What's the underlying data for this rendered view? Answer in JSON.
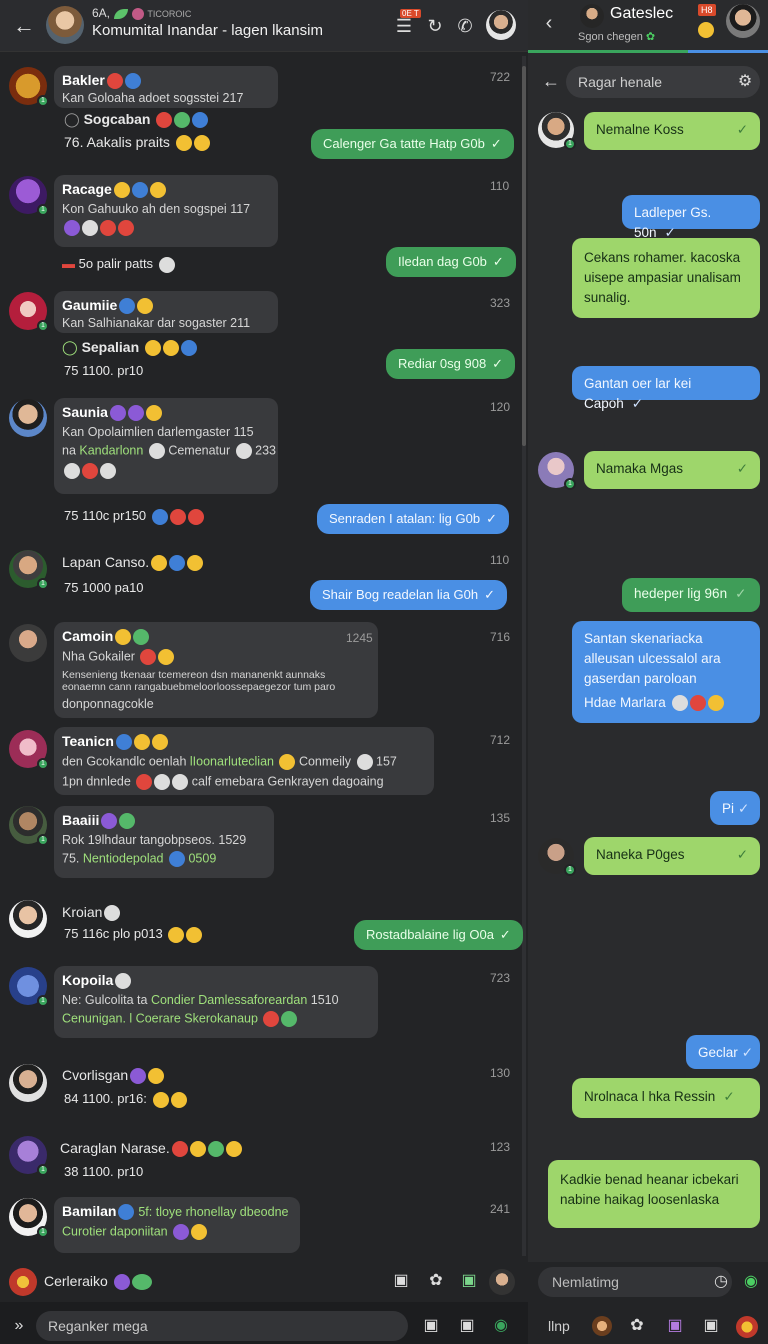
{
  "left": {
    "header": {
      "top_label": "6A,",
      "top_small": "TICOROIC",
      "title": "Komumital Inandar - lagen lkansim",
      "badge": "0E T"
    },
    "messages": [
      {
        "name": "Bakler",
        "line1": "Kan Goloaha adoet sogsstei",
        "num1": "217",
        "line2": "Sogcaban",
        "line3": "76. Aakalis praits",
        "time": "722"
      },
      {
        "name": "Racage",
        "line1": "Kon Gahuuko ah den sogspei",
        "num1": "117",
        "line3": "5o palir patts",
        "time": "110"
      },
      {
        "name": "Gaumiie",
        "line1": "Kan Salhianakar dar sogaster",
        "num1": "211",
        "line2": "Sepalian",
        "line3": "75 1100. pr10",
        "time": "323"
      },
      {
        "name": "Saunia",
        "line1": "Kan Opolaimlien darlemgaster",
        "num1": "115",
        "line2a": "na",
        "line2b": "Kandarlonn",
        "line2c": "Cemenatur",
        "num2": "233",
        "line3": "75 110c pr150",
        "time": "120"
      },
      {
        "name": "Lapan Canso.",
        "line1": "75 1000 pa10",
        "time": "110"
      },
      {
        "name": "Camoin",
        "line1": "Nha Gokailer",
        "line2": "Kensenieng tkenaar tcemereon dsn mananenkt aunnaks eonaemn cann rangabuebmeloorloossepaegezor tum paro",
        "line3": "donponnagcokle",
        "num1": "1245",
        "time": "716"
      },
      {
        "name": "Teanicn",
        "line1": "den Gcokandlc oenlah",
        "line1g": "lIoonarluteclian",
        "line1b": "Conmeily",
        "num1": "157",
        "line2": "1pn dnnlede",
        "line2b": "calf emebara Genkrayen dagoaing",
        "time": "712"
      },
      {
        "name": "Baaiii",
        "line1": "Rok 19lhdaur tangobpseos.",
        "num1": "1529",
        "line2a": "75.",
        "line2g": "Nentiodepolad",
        "line2n": "0509",
        "time": "135"
      },
      {
        "name": "Kroian",
        "line1": "75 116c plo p013"
      },
      {
        "name": "Kopoila",
        "line1": "Ne: Gulcolita ta",
        "line1g": "Condier Damlessaforeardan",
        "num1": "1510",
        "line2g": "Cenunigan. l Coerare Skerokanaup",
        "time": "723"
      },
      {
        "name": "Cvorlisgan",
        "line1": "84 1100. pr16:",
        "time": "130"
      },
      {
        "name": "Caraglan Narase.",
        "line1": "38 1100. pr10",
        "time": "123"
      },
      {
        "name": "Bamilan",
        "line1g": "5f: tloye rhonellay dbeodne",
        "line2g": "Curotier daponiitan",
        "time": "241"
      }
    ],
    "outgoing": [
      "Calenger Ga tatte Hatp G0b",
      "Iledan dag G0b",
      "Rediar 0sg 908",
      "Senraden I atalan: lig G0b",
      "Shair Bog readelan lia G0h",
      "Rostadbalaine lig O0a"
    ],
    "bottom": {
      "name": "Cerleraiko",
      "input_placeholder": "Reganker mega"
    }
  },
  "right": {
    "header": {
      "title": "Gateslec",
      "subtitle": "Sgon chegen",
      "badge": "H8"
    },
    "search_placeholder": "Ragar henale",
    "messages": [
      {
        "text": "Nemalne Koss"
      },
      {
        "text": "Ladleper Gs. 50n"
      },
      {
        "text": "Cekans rohamer. kacoska uisepe ampasiar unalisam sunalig."
      },
      {
        "text": "Gantan oer lar kei Capoh"
      },
      {
        "text": "Namaka Mgas"
      },
      {
        "text": "hedeper lig 96n"
      },
      {
        "text": "Santan skenariacka alleusan ulcessalol ara gaserdan paroloan"
      },
      {
        "text": "Hdae Marlara"
      },
      {
        "text": "Pi"
      },
      {
        "text": "Naneka P0ges"
      },
      {
        "text": "Geclar"
      },
      {
        "text": "Nrolnaca l hka Ressin"
      },
      {
        "text": "Kadkie benad heanar icbekari nabine haikag loosenlaska"
      }
    ],
    "input_placeholder": "Nemlatimg",
    "bottom_label": "llnp"
  },
  "colors": {
    "green_bubble": "#3f9d58",
    "blue_bubble": "#4a8fe4",
    "light_green_bubble": "#9ed66b",
    "dark_bg": "#232426"
  }
}
